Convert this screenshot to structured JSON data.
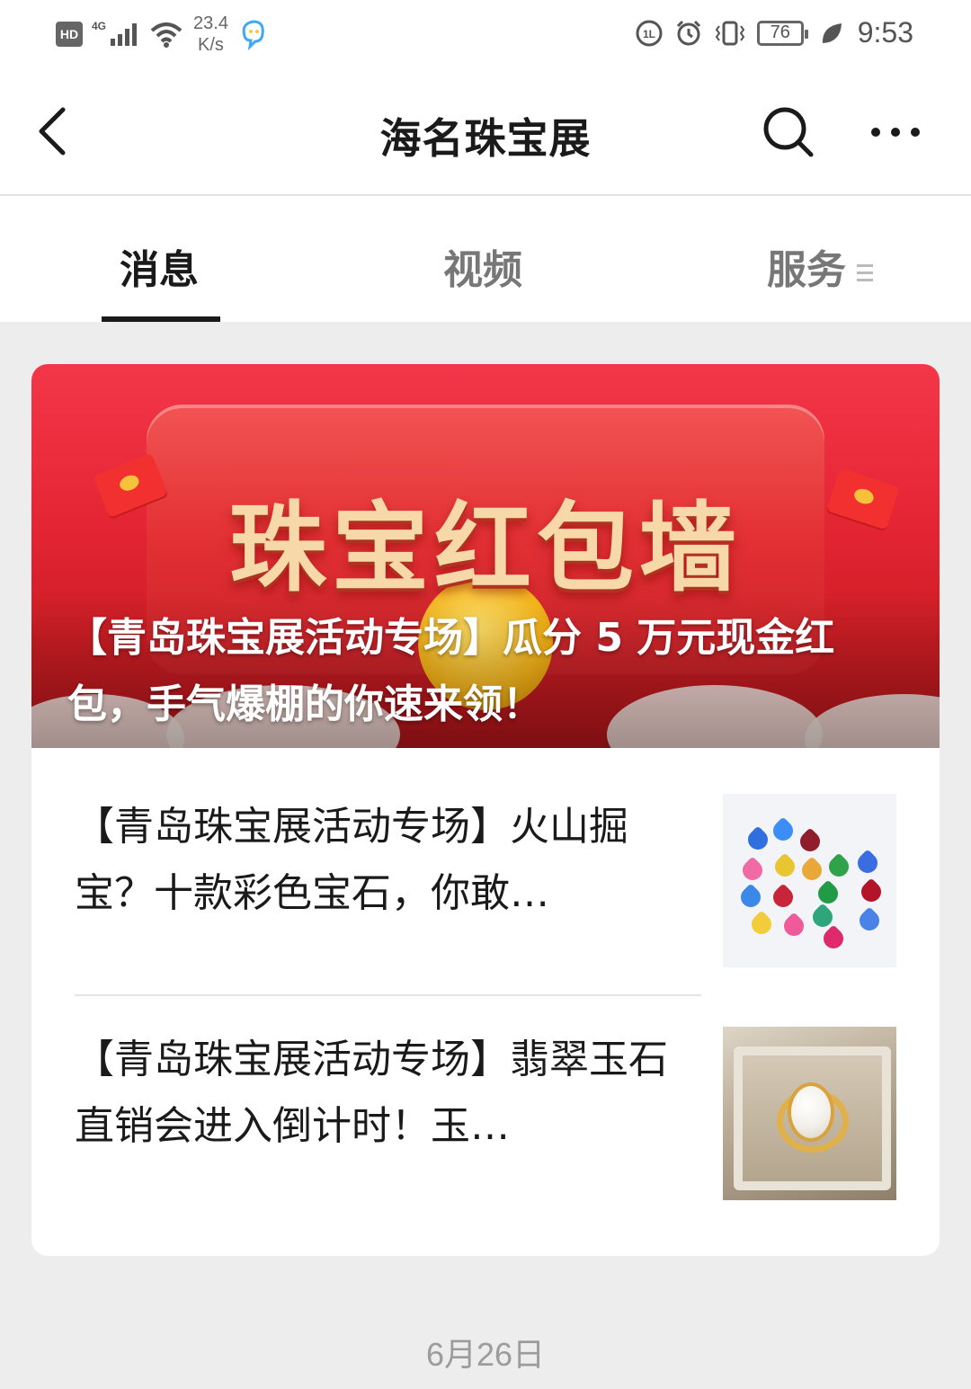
{
  "status_bar": {
    "hd_label": "HD",
    "network_label": "4G",
    "speed_value": "23.4",
    "speed_unit": "K/s",
    "battery_level": "76",
    "time": "9:53",
    "icons": [
      "signal-icon",
      "wifi-icon",
      "assistant-icon",
      "hd-voice-icon",
      "alarm-icon",
      "vibrate-icon",
      "battery-icon",
      "eco-leaf-icon"
    ]
  },
  "nav": {
    "title": "海名珠宝展",
    "icons": [
      "back-arrow-icon",
      "search-icon",
      "more-icon"
    ]
  },
  "tabs": [
    {
      "label": "消息",
      "active": true
    },
    {
      "label": "视频",
      "active": false
    },
    {
      "label": "服务",
      "active": false
    }
  ],
  "article_card": {
    "banner": {
      "image_text": "珠宝红包墙",
      "caption": "【青岛珠宝展活动专场】瓜分 5 万元现金红包，手气爆棚的你速来领！"
    },
    "items": [
      {
        "title": "【青岛珠宝展活动专场】火山掘宝？十款彩色宝石，你敢…",
        "thumb": "gemstones-thumbnail"
      },
      {
        "title": "【青岛珠宝展活动专场】翡翠玉石直销会进入倒计时！玉…",
        "thumb": "jade-ring-thumbnail"
      }
    ]
  },
  "date_label": "6月26日",
  "colors": {
    "banner_red": "#e22432",
    "background": "#ededed",
    "active_tab": "#1a1a1a",
    "inactive_tab": "#777777"
  }
}
